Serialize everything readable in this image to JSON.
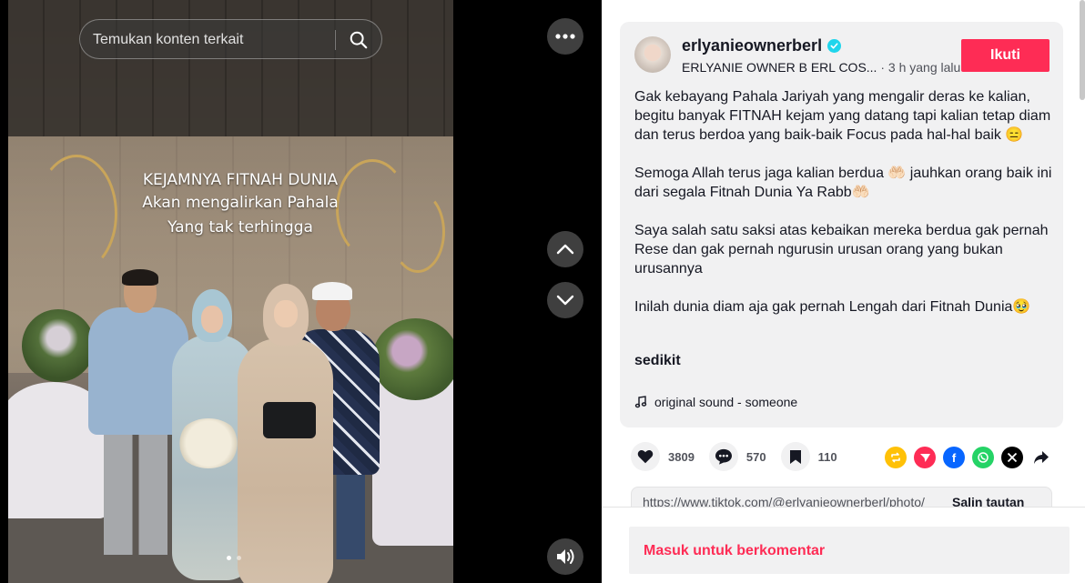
{
  "search": {
    "placeholder": "Temukan konten terkait"
  },
  "overlay": {
    "line1": "KEJAMNYA FITNAH DUNIA",
    "line2": "Akan mengalirkan Pahala",
    "line3": "Yang tak terhingga"
  },
  "post": {
    "username": "erlyanieownerberl",
    "display_name": "ERLYANIE OWNER B ERL COS...",
    "time": "3 h yang lalu",
    "follow_label": "Ikuti",
    "caption": [
      "Gak kebayang Pahala Jariyah yang mengalir deras ke kalian, begitu banyak FITNAH kejam yang datang tapi kalian tetap diam dan terus berdoa yang baik-baik Focus pada hal-hal baik 😑",
      "Semoga Allah terus jaga kalian berdua 🤲🏻 jauhkan orang baik ini dari segala Fitnah Dunia Ya Rabb🤲🏻",
      "Saya salah satu saksi atas kebaikan mereka berdua gak pernah Rese dan gak pernah ngurusin urusan orang yang bukan urusannya",
      "Inilah dunia diam aja gak pernah Lengah dari Fitnah Dunia🥹"
    ],
    "more_label": "sedikit",
    "sound": "original sound - someone"
  },
  "stats": {
    "likes": "3809",
    "comments": "570",
    "saves": "110"
  },
  "share": {
    "url": "https://www.tiktok.com/@erlyanieownerberl/photo/",
    "copy_label": "Salin tautan"
  },
  "comments": {
    "login_label": "Masuk untuk berkomentar"
  },
  "colors": {
    "accent": "#fe2c55",
    "verified": "#20d5ec",
    "text": "#161823"
  }
}
